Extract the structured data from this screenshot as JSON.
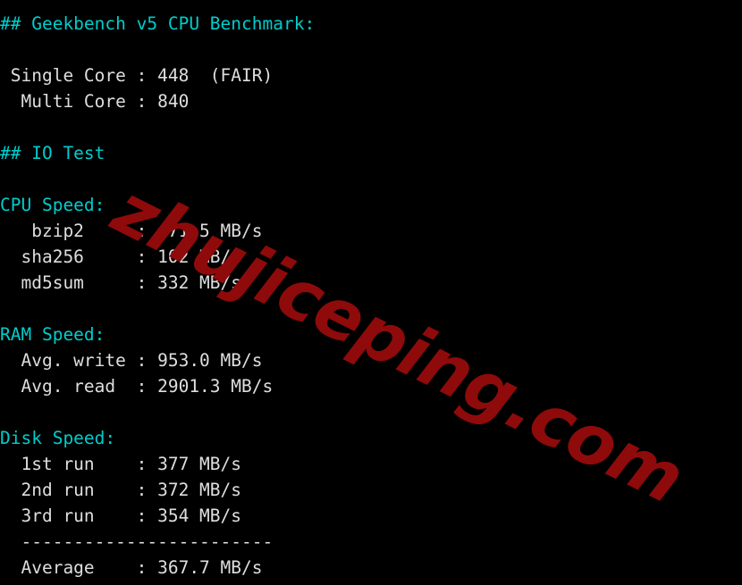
{
  "terminal": {
    "background_color": "#000000",
    "text_color": "#dededf",
    "heading_color": "#00cdcd",
    "lines": [
      {
        "id": "geekbench-heading",
        "text": "## Geekbench v5 CPU Benchmark:",
        "style": "heading"
      },
      {
        "id": "blank-1",
        "text": " ",
        "style": "blank"
      },
      {
        "id": "single-core-row",
        "text": " Single Core : 448  (FAIR)",
        "style": "text"
      },
      {
        "id": "multi-core-row",
        "text": "  Multi Core : 840",
        "style": "text"
      },
      {
        "id": "blank-2",
        "text": " ",
        "style": "blank"
      },
      {
        "id": "io-test-heading",
        "text": "## IO Test",
        "style": "heading"
      },
      {
        "id": "blank-3",
        "text": " ",
        "style": "blank"
      },
      {
        "id": "cpu-speed-heading",
        "text": "CPU Speed:",
        "style": "heading"
      },
      {
        "id": "bzip2-row",
        "text": "   bzip2     :  71.5 MB/s",
        "style": "text"
      },
      {
        "id": "sha256-row",
        "text": "  sha256     : 102 MB/s",
        "style": "text"
      },
      {
        "id": "md5sum-row",
        "text": "  md5sum     : 332 MB/s",
        "style": "text"
      },
      {
        "id": "blank-4",
        "text": " ",
        "style": "blank"
      },
      {
        "id": "ram-speed-heading",
        "text": "RAM Speed:",
        "style": "heading"
      },
      {
        "id": "ram-write-row",
        "text": "  Avg. write : 953.0 MB/s",
        "style": "text"
      },
      {
        "id": "ram-read-row",
        "text": "  Avg. read  : 2901.3 MB/s",
        "style": "text"
      },
      {
        "id": "blank-5",
        "text": " ",
        "style": "blank"
      },
      {
        "id": "disk-speed-heading",
        "text": "Disk Speed:",
        "style": "heading"
      },
      {
        "id": "disk-run-1-row",
        "text": "  1st run    : 377 MB/s",
        "style": "text"
      },
      {
        "id": "disk-run-2-row",
        "text": "  2nd run    : 372 MB/s",
        "style": "text"
      },
      {
        "id": "disk-run-3-row",
        "text": "  3rd run    : 354 MB/s",
        "style": "text"
      },
      {
        "id": "disk-separator",
        "text": "  ------------------------",
        "style": "text"
      },
      {
        "id": "disk-average-row",
        "text": "  Average    : 367.7 MB/s",
        "style": "text"
      }
    ]
  },
  "watermark": {
    "text": "zhujiceping.com",
    "color": "#8f0a0a",
    "rotation_deg": 26.5
  },
  "benchmark_results": {
    "geekbench_v5": {
      "title": "## Geekbench v5 CPU Benchmark:",
      "single_core_label": "Single Core",
      "single_core_score": "448",
      "single_core_rating": "(FAIR)",
      "multi_core_label": "Multi Core",
      "multi_core_score": "840"
    },
    "io_test": {
      "title": "## IO Test",
      "cpu_speed": {
        "title": "CPU Speed:",
        "rows": [
          {
            "label": "bzip2",
            "value": "71.5 MB/s"
          },
          {
            "label": "sha256",
            "value": "102 MB/s"
          },
          {
            "label": "md5sum",
            "value": "332 MB/s"
          }
        ]
      },
      "ram_speed": {
        "title": "RAM Speed:",
        "rows": [
          {
            "label": "Avg. write",
            "value": "953.0 MB/s"
          },
          {
            "label": "Avg. read",
            "value": "2901.3 MB/s"
          }
        ]
      },
      "disk_speed": {
        "title": "Disk Speed:",
        "rows": [
          {
            "label": "1st run",
            "value": "377 MB/s"
          },
          {
            "label": "2nd run",
            "value": "372 MB/s"
          },
          {
            "label": "3rd run",
            "value": "354 MB/s"
          }
        ],
        "separator": "------------------------",
        "average_label": "Average",
        "average_value": "367.7 MB/s"
      }
    }
  }
}
